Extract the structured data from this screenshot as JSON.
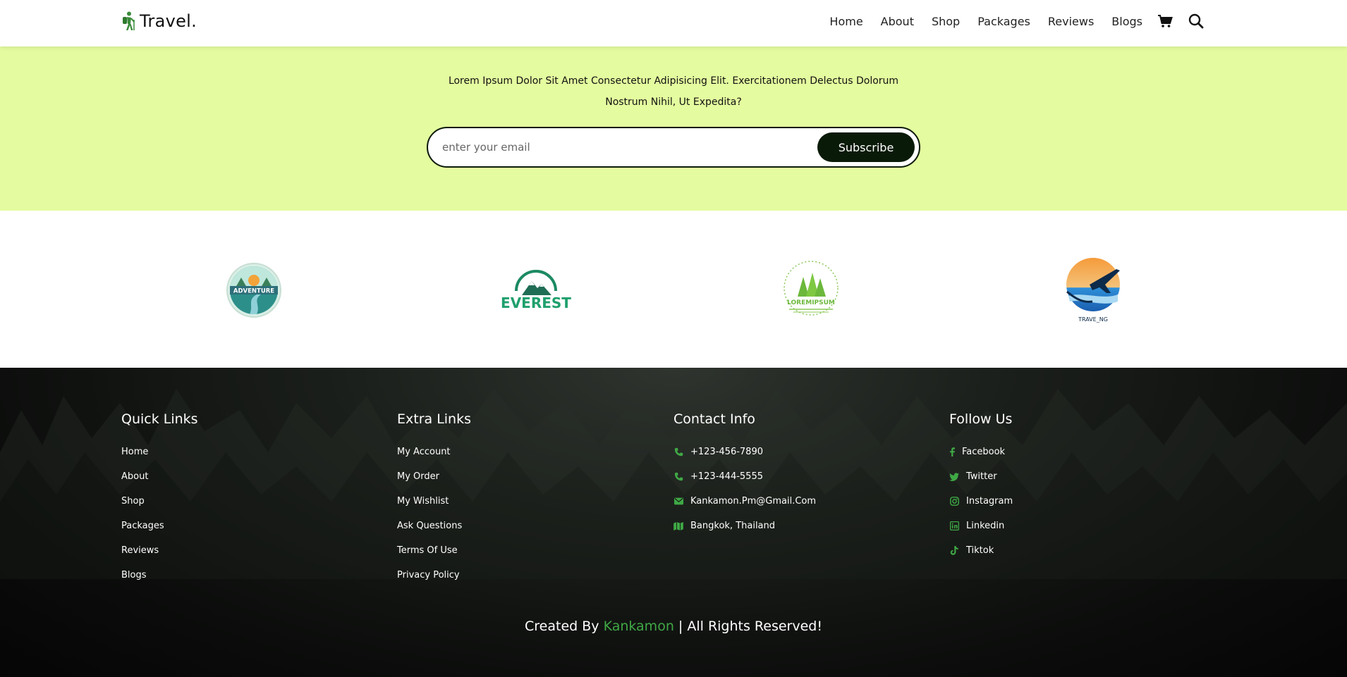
{
  "header": {
    "logo_text": "Travel.",
    "nav": [
      {
        "label": "Home"
      },
      {
        "label": "About"
      },
      {
        "label": "Shop"
      },
      {
        "label": "Packages"
      },
      {
        "label": "Reviews"
      },
      {
        "label": "Blogs"
      }
    ],
    "icons": [
      "cart-icon",
      "search-icon"
    ]
  },
  "newsletter": {
    "text": "Lorem Ipsum Dolor Sit Amet Consectetur Adipisicing Elit. Exercitationem Delectus Dolorum Nostrum Nihil, Ut Expedita?",
    "email_placeholder": "enter your email",
    "subscribe_label": "Subscribe",
    "background": "#e4fc9f"
  },
  "brands": [
    {
      "name": "adventure-logo",
      "text": "ADVENTURE"
    },
    {
      "name": "everest-logo",
      "text": "EVEREST"
    },
    {
      "name": "loremipsum-logo",
      "text": "LOREMIPSUM"
    },
    {
      "name": "traveling-logo",
      "text": "TRAVE_NG"
    }
  ],
  "footer": {
    "quick_links": {
      "title": "Quick Links",
      "items": [
        "Home",
        "About",
        "Shop",
        "Packages",
        "Reviews",
        "Blogs"
      ]
    },
    "extra_links": {
      "title": "Extra Links",
      "items": [
        "My Account",
        "My Order",
        "My Wishlist",
        "Ask Questions",
        "Terms Of Use",
        "Privacy Policy"
      ]
    },
    "contact_info": {
      "title": "Contact Info",
      "items": [
        {
          "icon": "phone-icon",
          "text": "+123-456-7890"
        },
        {
          "icon": "phone-icon",
          "text": "+123-444-5555"
        },
        {
          "icon": "envelope-icon",
          "text": "Kankamon.Pm@Gmail.Com"
        },
        {
          "icon": "map-icon",
          "text": "Bangkok, Thailand"
        }
      ]
    },
    "follow_us": {
      "title": "Follow Us",
      "items": [
        {
          "icon": "facebook-icon",
          "text": "Facebook"
        },
        {
          "icon": "twitter-icon",
          "text": "Twitter"
        },
        {
          "icon": "instagram-icon",
          "text": "Instagram"
        },
        {
          "icon": "linkedin-icon",
          "text": "Linkedin"
        },
        {
          "icon": "tiktok-icon",
          "text": "Tiktok"
        }
      ]
    },
    "credit": {
      "prefix": "Created By ",
      "author": "Kankamon",
      "suffix": " | All Rights Reserved!"
    },
    "accent_color": "#3fa845"
  }
}
